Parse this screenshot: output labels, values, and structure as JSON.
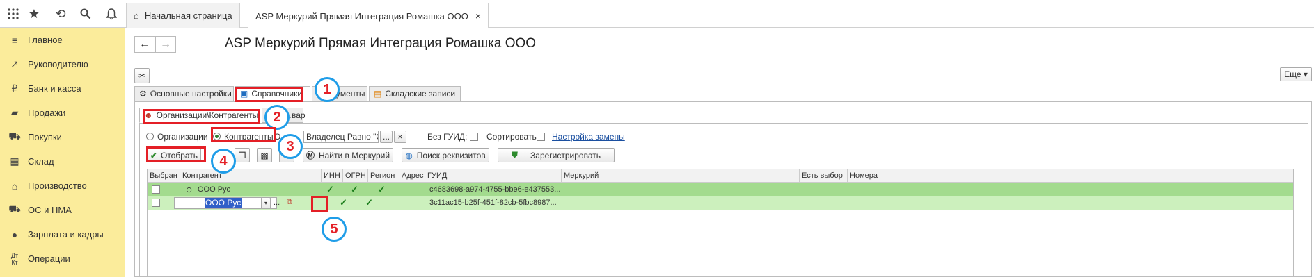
{
  "topbar": {
    "icons": [
      "apps-grid-icon",
      "star-icon",
      "history-icon",
      "search-icon",
      "bell-icon"
    ],
    "tabs": {
      "home": "Начальная страница",
      "active": "ASP Меркурий Прямая Интеграция Ромашка ООО"
    }
  },
  "sidebar": {
    "items": [
      {
        "label": "Главное",
        "icon": "menu-icon"
      },
      {
        "label": "Руководителю",
        "icon": "trend-icon"
      },
      {
        "label": "Банк и касса",
        "icon": "ruble-icon"
      },
      {
        "label": "Продажи",
        "icon": "bag-icon"
      },
      {
        "label": "Покупки",
        "icon": "cart-icon"
      },
      {
        "label": "Склад",
        "icon": "warehouse-icon"
      },
      {
        "label": "Производство",
        "icon": "factory-icon"
      },
      {
        "label": "ОС и НМА",
        "icon": "truck-icon"
      },
      {
        "label": "Зарплата и кадры",
        "icon": "person-icon"
      },
      {
        "label": "Операции",
        "icon": "dt-kt-icon"
      }
    ]
  },
  "main": {
    "title": "ASP Меркурий Прямая Интеграция Ромашка ООО",
    "more_button": "Еще ▾",
    "tabs": [
      "Основные настройки",
      "Справочники",
      "…ументы",
      "Складские записи"
    ],
    "subtabs": [
      "Организации\\Контрагенты",
      "…вар"
    ],
    "radio": {
      "option1": "Организации",
      "option2": "Контрагенты"
    },
    "filter": {
      "prefix": "О",
      "value": "Владелец Равно \"ООО Р",
      "ellipsis": "...",
      "clear": "×",
      "no_guid_label": "Без ГУИД:",
      "sort_label": "Сортировать:",
      "replace_link": "Настройка замены"
    },
    "buttons": {
      "select": "Отобрать",
      "find": "Найти в Меркурий",
      "search_req": "Поиск реквизитов",
      "register": "Зарегистрировать"
    },
    "grid": {
      "columns": [
        "Выбран",
        "Контрагент",
        "ИНН",
        "ОГРН",
        "Регион",
        "Адрес",
        "ГУИД",
        "Меркурий",
        "Есть выбор",
        "Номера"
      ],
      "rows": [
        {
          "name": "ООО Рус",
          "guid": "c4683698-a974-4755-bbe6-e437553...",
          "inn": "✓",
          "ogrn": "✓",
          "region": "✓",
          "address": ""
        },
        {
          "name": "ООО Рус",
          "guid": "3c11ac15-b25f-451f-82cb-5fbc8987...",
          "inn": "",
          "ogrn": "",
          "region": "✓",
          "address": "✓"
        }
      ]
    },
    "annotations": [
      "1",
      "2",
      "3",
      "4",
      "5"
    ]
  }
}
